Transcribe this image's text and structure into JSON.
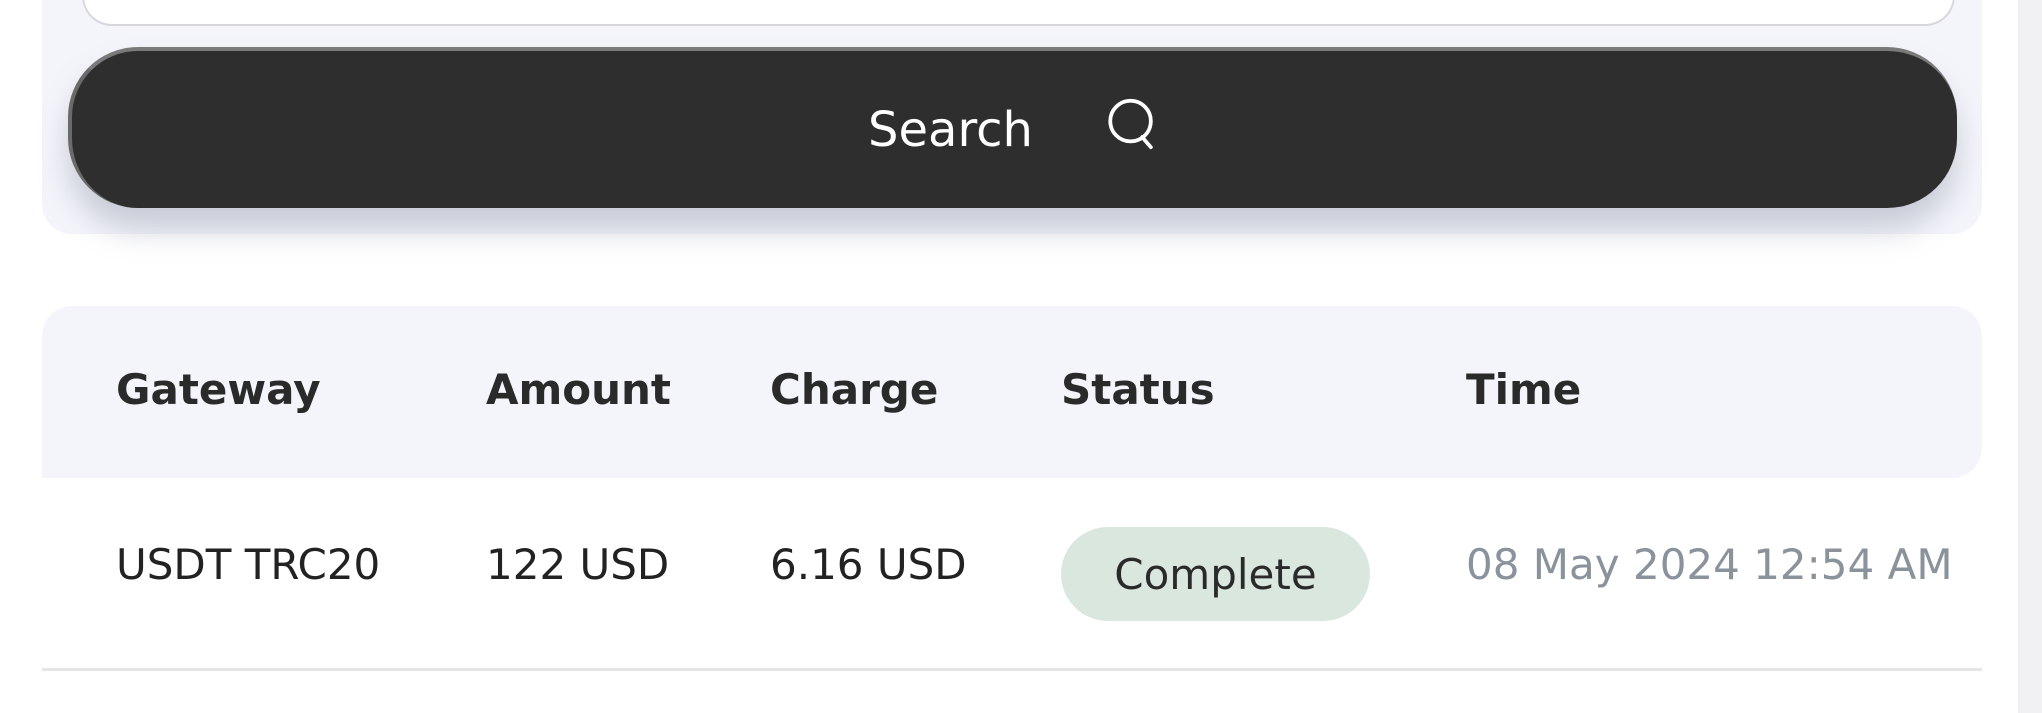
{
  "search": {
    "button_label": "Search",
    "icon": "search-icon"
  },
  "table": {
    "headers": [
      "Gateway",
      "Amount",
      "Charge",
      "Status",
      "Time"
    ],
    "rows": [
      {
        "gateway": "USDT TRC20",
        "amount": "122 USD",
        "charge": "6.16 USD",
        "status": "Complete",
        "time": "08 May 2024 12:54 AM"
      }
    ]
  },
  "colors": {
    "button_bg": "#2e2e2e",
    "panel_bg": "#f4f5fb",
    "status_complete_bg": "#dae7de",
    "time_text": "#8a939b"
  }
}
